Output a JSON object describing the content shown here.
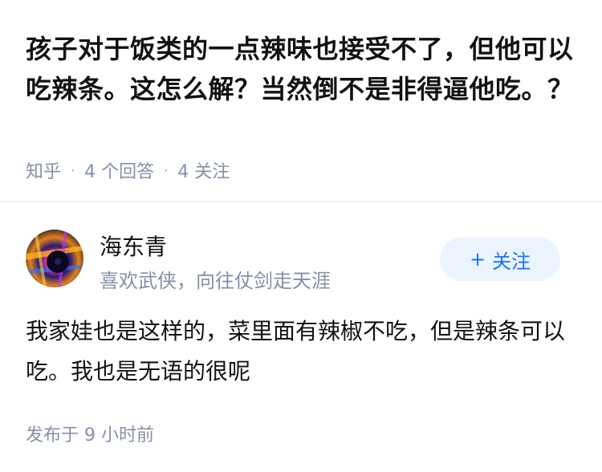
{
  "question": {
    "title": "孩子对于饭类的一点辣味也接受不了，但他可以吃辣条。这怎么解？当然倒不是非得逼他吃。？",
    "source": "知乎",
    "answer_count": "4 个回答",
    "follower_count": "4 关注"
  },
  "answer": {
    "author": {
      "name": "海东青",
      "bio": "喜欢武侠，向往仗剑走天涯"
    },
    "follow": {
      "icon": "+",
      "label": "关注"
    },
    "content": "我家娃也是这样的，菜里面有辣椒不吃，但是辣条可以吃。我也是无语的很呢",
    "time": "发布于 9 小时前"
  },
  "colors": {
    "text": "#121212",
    "meta": "#8590a6",
    "accent": "#1772f6",
    "follow_bg": "#ebf3fc"
  }
}
